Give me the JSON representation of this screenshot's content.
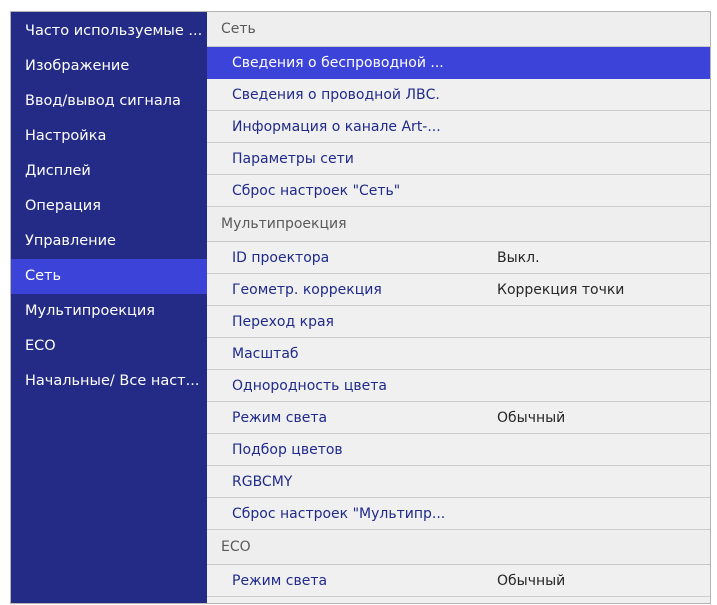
{
  "sidebar": {
    "items": [
      {
        "label": "Часто используемые ..."
      },
      {
        "label": "Изображение"
      },
      {
        "label": "Ввод/вывод сигнала"
      },
      {
        "label": "Настройка"
      },
      {
        "label": "Дисплей"
      },
      {
        "label": "Операция"
      },
      {
        "label": "Управление"
      },
      {
        "label": "Сеть"
      },
      {
        "label": "Мультипроекция"
      },
      {
        "label": "ECO"
      },
      {
        "label": "Начальные/ Все наст..."
      }
    ],
    "active_item": "Сеть"
  },
  "main": {
    "network": {
      "header": "Сеть",
      "items": [
        {
          "label": "Сведения о беспроводной ..."
        },
        {
          "label": "Сведения о проводной ЛВС."
        },
        {
          "label": "Информация о канале Art-..."
        },
        {
          "label": "Параметры сети"
        },
        {
          "label": "Сброс настроек \"Сеть\""
        }
      ]
    },
    "multiprojection": {
      "header": "Мультипроекция",
      "items": [
        {
          "label": "ID проектора",
          "value": "Выкл."
        },
        {
          "label": "Геометр. коррекция",
          "value": "Коррекция точки"
        },
        {
          "label": "Переход края",
          "value": ""
        },
        {
          "label": "Масштаб",
          "value": ""
        },
        {
          "label": "Однородность цвета",
          "value": ""
        },
        {
          "label": "Режим света",
          "value": "Обычный"
        },
        {
          "label": "Подбор цветов",
          "value": ""
        },
        {
          "label": "RGBCMY",
          "value": ""
        },
        {
          "label": "Сброс настроек \"Мультипр...",
          "value": ""
        }
      ]
    },
    "eco": {
      "header": "ECO",
      "items": [
        {
          "label": "Режим света",
          "value": "Обычный"
        }
      ]
    }
  },
  "colors": {
    "sidebar_bg": "#232b86",
    "selection": "#3c43d8",
    "panel_bg": "#f0f0f0",
    "item_text": "#1f2a8a"
  }
}
